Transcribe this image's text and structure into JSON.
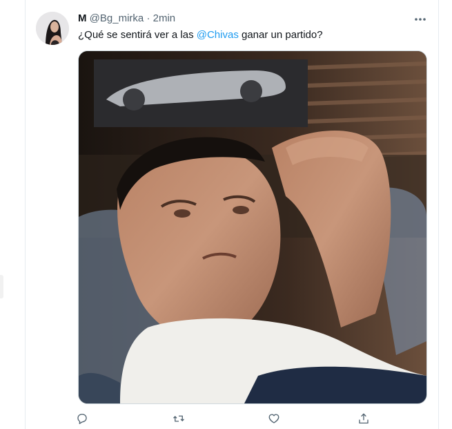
{
  "tweet": {
    "display_name": "M",
    "handle": "@Bg_mirka",
    "separator": "·",
    "time": "2min",
    "text_before": "¿Qué se sentirá ver a las ",
    "mention": "@Chivas",
    "text_after": " ganar un partido?"
  },
  "colors": {
    "accent": "#1d9bf0",
    "text_primary": "#0f1419",
    "text_secondary": "#536471",
    "border": "#e6ecf0"
  },
  "icons": {
    "more": "more-horizontal-icon",
    "reply": "reply-icon",
    "retweet": "retweet-icon",
    "like": "heart-icon",
    "share": "share-icon"
  }
}
